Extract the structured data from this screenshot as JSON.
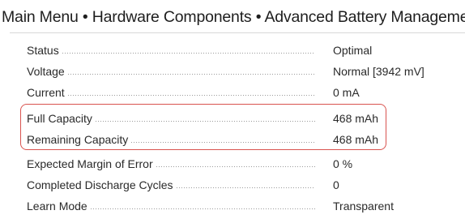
{
  "breadcrumb": {
    "items": [
      "Main Menu",
      "Hardware Components",
      "Advanced Battery Management"
    ],
    "separator": "•"
  },
  "fields": [
    {
      "label": "Status",
      "value": "Optimal"
    },
    {
      "label": "Voltage",
      "value": "Normal [3942 mV]"
    },
    {
      "label": "Current",
      "value": "0 mA"
    },
    {
      "label": "Full Capacity",
      "value": "468 mAh"
    },
    {
      "label": "Remaining Capacity",
      "value": "468 mAh"
    },
    {
      "label": "Expected Margin of Error",
      "value": "0 %"
    },
    {
      "label": "Completed Discharge Cycles",
      "value": "0"
    },
    {
      "label": "Learn Mode",
      "value": "Transparent"
    }
  ],
  "highlight": {
    "rows": [
      "Full Capacity",
      "Remaining Capacity"
    ],
    "color": "#d9534f"
  }
}
